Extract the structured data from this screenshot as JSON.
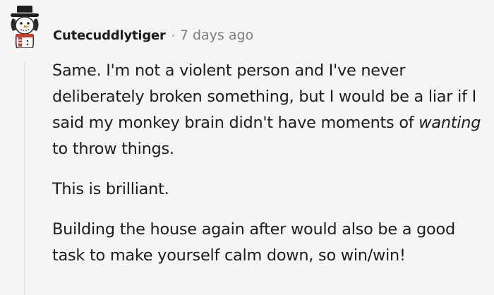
{
  "comment": {
    "author": "Cutecuddlytiger",
    "separator": "·",
    "timestamp": "7 days ago",
    "avatar_icon": "snowman-top-hat-avatar",
    "paragraphs": [
      {
        "before": "Same. I'm not a violent person and I've never deliberately broken something, but I would be a liar if I said my monkey brain didn't have moments of ",
        "emphasis": "wanting",
        "after": " to throw things."
      },
      {
        "text": "This is brilliant."
      },
      {
        "text": "Building the house again after would also be a good task to make yourself calm down, so win/win!"
      }
    ]
  },
  "colors": {
    "background": "#f5f5f4",
    "text": "#1c1c1c",
    "meta": "#7c7c7c",
    "thread_line": "#e2e3e5"
  }
}
